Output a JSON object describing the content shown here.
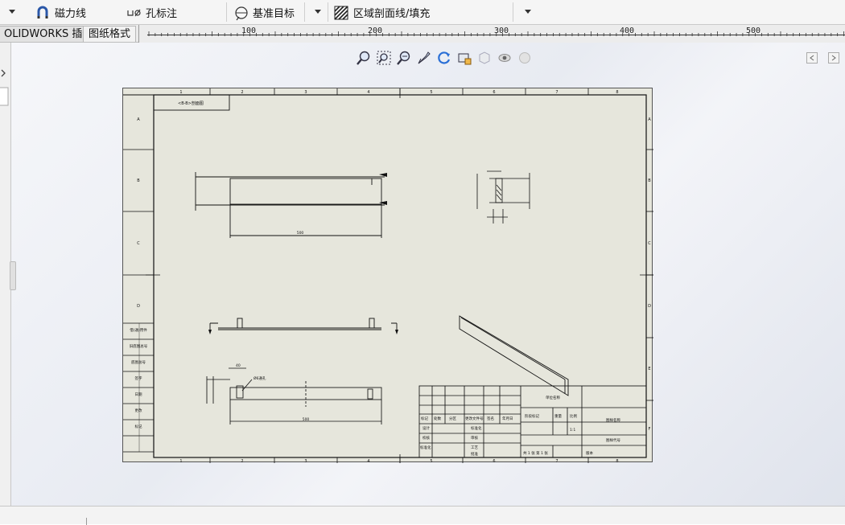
{
  "ribbon": {
    "items": [
      {
        "label": "磁力线",
        "icon": "magnet-line-icon"
      },
      {
        "label": "孔标注",
        "icon": "hole-callout-icon"
      },
      {
        "label": "基准目标",
        "icon": "datum-target-icon"
      },
      {
        "label": "区域剖面线/填充",
        "icon": "area-hatch-icon"
      }
    ]
  },
  "tabs": [
    {
      "label": "OLIDWORKS 插件"
    },
    {
      "label": "图纸格式"
    }
  ],
  "ruler": {
    "ticks": [
      "100",
      "200",
      "300",
      "400",
      "500"
    ]
  },
  "heads_up_toolbar": {
    "icons": [
      "zoom-to-fit-icon",
      "zoom-to-area-icon",
      "zoom-in-out-icon",
      "pan-icon",
      "rotate-icon",
      "view-orientation-icon",
      "display-style-icon",
      "hide-show-icon",
      "appearance-icon"
    ]
  },
  "drawing": {
    "note": "<B-B>剖面图",
    "dim_front_length": "500",
    "dim_bottom_length": "500",
    "dim_detail": "Ø6通孔",
    "dim_top": "40",
    "zone_numbers_top": [
      "1",
      "2",
      "3",
      "4",
      "5",
      "6",
      "7",
      "8"
    ],
    "zone_letters_side": [
      "A",
      "B",
      "C",
      "D",
      "E",
      "F"
    ],
    "left_strip_labels": [
      "借(通)用件",
      "旧底图总号",
      "底图总号",
      "签字",
      "日期",
      "更改",
      "标记"
    ],
    "title_block": {
      "company": "单位名称",
      "drawing_name": "图样名称",
      "drawing_no": "图样代号",
      "headers": [
        "标记",
        "处数",
        "分区",
        "更改文件号",
        "签名",
        "年月日"
      ],
      "rows": [
        "设计",
        "校核",
        "工艺",
        "标准化",
        "审核",
        "批准"
      ],
      "stage": "阶段标记",
      "weight": "重量",
      "scale": "比例",
      "scale_value": "1:1",
      "sheet_info": "共 1 张  第 1 张",
      "version": "版本"
    }
  },
  "colors": {
    "sheet_bg": "#e6e6dc",
    "line": "#111111"
  }
}
